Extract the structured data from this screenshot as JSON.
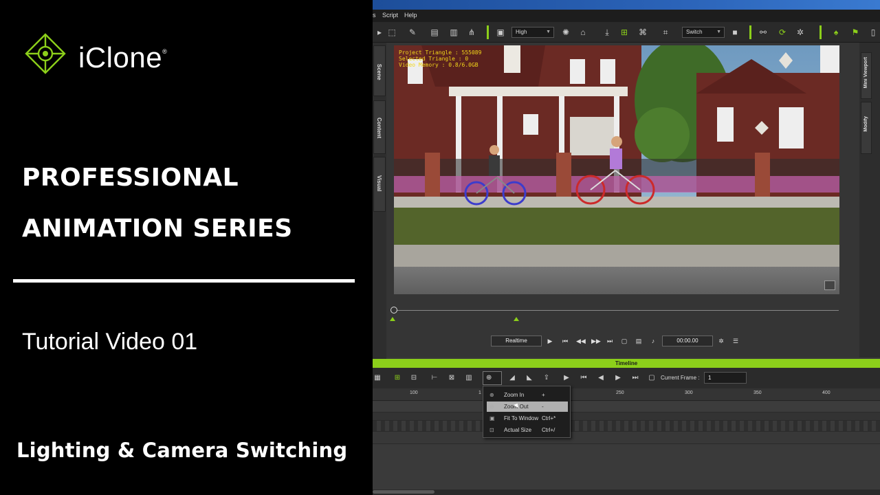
{
  "promo": {
    "brand": "iClone",
    "brand_mark": "®",
    "headline_line1": "PROFESSIONAL",
    "headline_line2": "ANIMATION SERIES",
    "subtitle": "Tutorial Video 01",
    "topic": "Lighting & Camera Switching"
  },
  "menu": {
    "items": [
      "s",
      "Script",
      "Help"
    ]
  },
  "toolbar": {
    "quality_value": "High",
    "switch_value": "Switch"
  },
  "side_tabs": {
    "scene": "Scene",
    "content": "Content",
    "visual": "Visual"
  },
  "right_tabs": {
    "mini_viewport": "Mini Viewport",
    "modify": "Modify"
  },
  "viewport": {
    "stats": [
      "Project Triangle : 555089",
      "Selected Triangle : 0",
      "Video Memory : 0.8/6.0GB"
    ]
  },
  "playbar": {
    "realtime_label": "Realtime",
    "timecode": "00:00.00"
  },
  "timeline": {
    "header": "Timeline",
    "current_frame_label": "Current Frame :",
    "current_frame_value": "1",
    "ruler_labels": [
      "100",
      "1",
      "250",
      "300",
      "350",
      "400"
    ]
  },
  "zoom_menu": {
    "items": [
      {
        "label": "Zoom In",
        "shortcut": "+"
      },
      {
        "label": "Zoom Out",
        "shortcut": "-"
      },
      {
        "label": "Fit To Window",
        "shortcut": "Ctrl+*"
      },
      {
        "label": "Actual Size",
        "shortcut": "Ctrl+/"
      }
    ]
  },
  "colors": {
    "accent_green": "#8ccf1a",
    "stats_yellow": "#f2d61a"
  }
}
